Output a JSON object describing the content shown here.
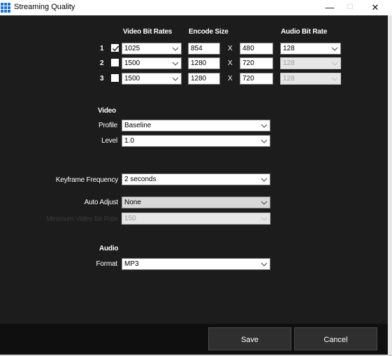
{
  "window": {
    "title": "Streaming Quality",
    "controls": {
      "minimize": "—",
      "maximize": "☐",
      "close": "✕"
    }
  },
  "headers": {
    "video_bit_rates": "Video Bit Rates",
    "encode_size": "Encode Size",
    "audio_bit_rate": "Audio Bit Rate"
  },
  "rows": [
    {
      "index": "1",
      "checked": true,
      "video_bit_rate": "1025",
      "width": "854",
      "x": "X",
      "height": "480",
      "audio_bit_rate": "128",
      "audio_enabled": true
    },
    {
      "index": "2",
      "checked": false,
      "video_bit_rate": "1500",
      "width": "1280",
      "x": "X",
      "height": "720",
      "audio_bit_rate": "128",
      "audio_enabled": false
    },
    {
      "index": "3",
      "checked": false,
      "video_bit_rate": "1500",
      "width": "1280",
      "x": "X",
      "height": "720",
      "audio_bit_rate": "128",
      "audio_enabled": false
    }
  ],
  "video": {
    "section_label": "Video",
    "profile_label": "Profile",
    "profile_value": "Baseline",
    "level_label": "Level",
    "level_value": "1.0"
  },
  "keyframe": {
    "label": "Keyframe Frequency",
    "value": "2 seconds"
  },
  "auto_adjust": {
    "label": "Auto Adjust",
    "value": "None",
    "min_label": "Minimum Video Bit Rate",
    "min_value": "150"
  },
  "audio": {
    "section_label": "Audio",
    "format_label": "Format",
    "format_value": "MP3"
  },
  "buttons": {
    "save": "Save",
    "cancel": "Cancel"
  },
  "colors": {
    "background": "#1c1c1c",
    "footer": "#0f0f0f",
    "button": "#2f2f2f",
    "icon_accent": "#1a73d9"
  }
}
